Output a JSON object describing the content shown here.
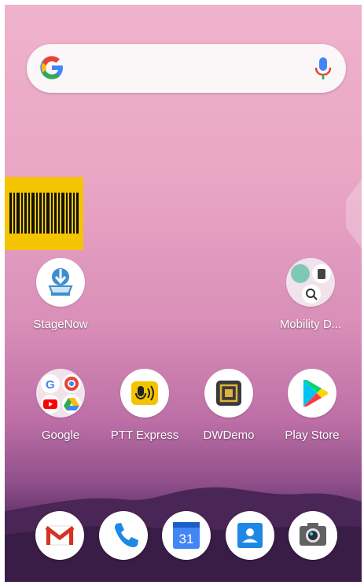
{
  "search_bar": {
    "google_logo": "google-g-icon",
    "mic": "microphone-icon"
  },
  "widgets": {
    "barcode": "barcode-icon"
  },
  "apps": [
    {
      "label": "StageNow",
      "icon": "stagenow-icon"
    },
    {
      "label": "Mobility D...",
      "icon": "mobility-folder-icon"
    }
  ],
  "row2": [
    {
      "label": "Google",
      "icon": "google-folder-icon"
    },
    {
      "label": "PTT Express",
      "icon": "ptt-express-icon"
    },
    {
      "label": "DWDemo",
      "icon": "dwdemo-icon"
    },
    {
      "label": "Play Store",
      "icon": "play-store-icon"
    }
  ],
  "dock": [
    {
      "icon": "gmail-icon"
    },
    {
      "icon": "phone-icon"
    },
    {
      "icon": "calendar-icon",
      "text": "31"
    },
    {
      "icon": "contacts-icon"
    },
    {
      "icon": "camera-icon"
    }
  ],
  "colors": {
    "accent_yellow": "#f4c400",
    "wallpaper_top": "#efb2cc",
    "wallpaper_bottom": "#3b1f48"
  }
}
